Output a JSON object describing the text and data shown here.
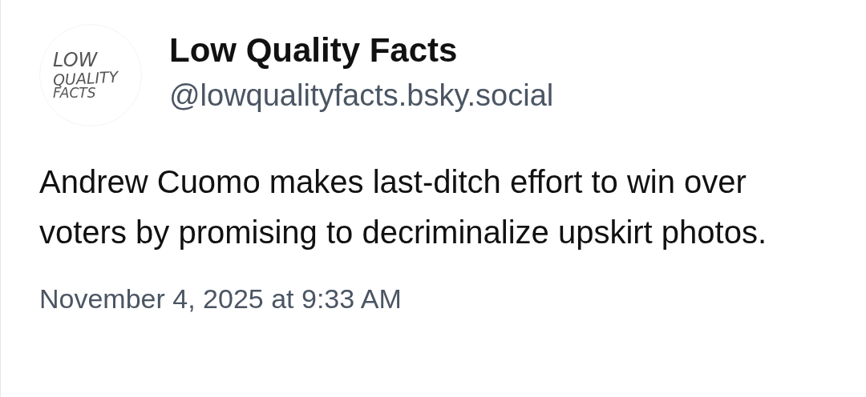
{
  "author": {
    "avatar_text": [
      "LOW",
      "QUALITY",
      "FACTS"
    ],
    "name": "Low Quality Facts",
    "handle": "@lowqualityfacts.bsky.social"
  },
  "post": {
    "text": "Andrew Cuomo makes last-ditch effort to win over voters by promising to decriminalize upskirt photos.",
    "timestamp": "November 4, 2025 at 9:33 AM"
  }
}
